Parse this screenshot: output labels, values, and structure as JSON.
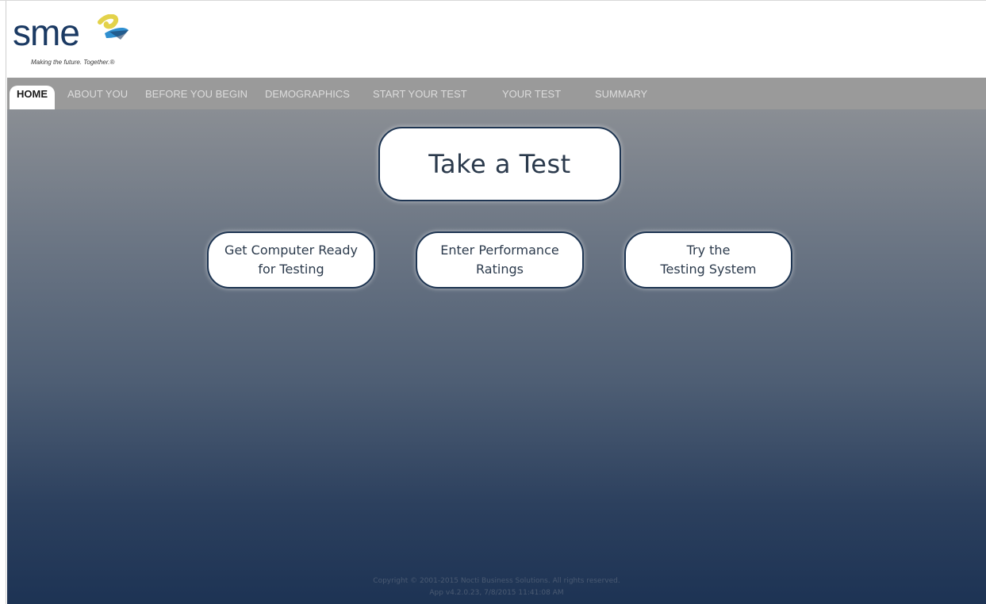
{
  "header": {
    "logo_text": "sme",
    "tagline": "Making the future. Together.®"
  },
  "nav": {
    "items": [
      {
        "label": "HOME",
        "active": true
      },
      {
        "label": "ABOUT YOU",
        "active": false
      },
      {
        "label": "BEFORE YOU BEGIN",
        "active": false
      },
      {
        "label": "DEMOGRAPHICS",
        "active": false
      },
      {
        "label": "START YOUR TEST",
        "active": false
      },
      {
        "label": "YOUR TEST",
        "active": false
      },
      {
        "label": "SUMMARY",
        "active": false
      }
    ]
  },
  "main": {
    "primary_button": "Take a Test",
    "secondary_buttons": [
      {
        "label": "Get Computer Ready\nfor Testing"
      },
      {
        "label": "Enter Performance\nRatings"
      },
      {
        "label": "Try the\nTesting System"
      }
    ]
  },
  "footer": {
    "copyright": "Copyright © 2001-2015 Nocti Business Solutions. All rights reserved.",
    "version": "App v4.2.0.23, 7/8/2015 11:41:08 AM"
  },
  "colors": {
    "nav_bg": "#9a9a9a",
    "brand_navy": "#1b3a63",
    "brand_blue": "#2f8fd0",
    "brand_yellow": "#e3d24a"
  },
  "icons": {
    "logo_mark": "sme-ribbon-logo"
  }
}
